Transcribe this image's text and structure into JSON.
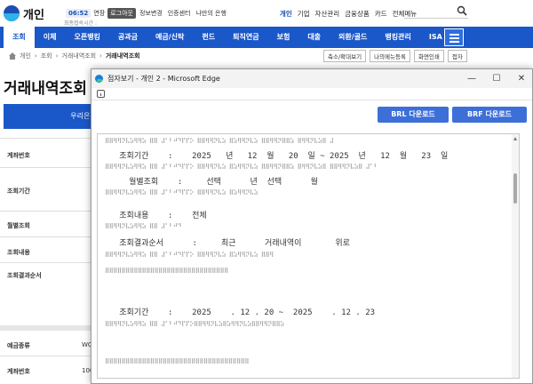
{
  "bank": {
    "logo_text": "개인",
    "session_timer": "06:52",
    "extend_label": "연장",
    "logout_label": "로그아웃",
    "top_links": [
      "정보변경",
      "인증센터",
      "나만의 은행"
    ],
    "biz_links": [
      "개인",
      "기업",
      "자산관리",
      "금융상품",
      "카드",
      "전체메뉴"
    ],
    "last_login": "최종접속시간 :",
    "nav": [
      "조회",
      "이체",
      "오픈뱅킹",
      "공과금",
      "예금/신탁",
      "펀드",
      "퇴직연금",
      "보험",
      "대출",
      "외환/골드",
      "뱅킹관리",
      "ISA"
    ],
    "breadcrumb": [
      "개인",
      "조회",
      "거래내역조회",
      "거래내역조회"
    ],
    "util_buttons": [
      "축소/확대보기",
      "나의메뉴등록",
      "화면인쇄",
      "접자"
    ],
    "page_title": "거래내역조회",
    "account_tab": "우리은행",
    "form_labels": [
      "계좌번호",
      "조회기간",
      "월별조회",
      "조회내용",
      "조회결과순서",
      "예금종류",
      "계좌번호"
    ],
    "side_values": [
      "WO",
      "100"
    ]
  },
  "popup": {
    "title": "점자보기 - 개인 2 - Microsoft Edge",
    "minimize": "—",
    "maximize": "☐",
    "close": "✕",
    "brl_button": "BRL 다운로드",
    "brf_button": "BRF 다운로드",
    "lines": [
      {
        "kind": "braille",
        "text": "⠿⠿⠻⠻⠝⠧⠵⠻⠻⠵ ⠿⠿ ⠼⠁⠃⠚⠙⠏⠏⠕ ⠿⠿⠻⠻⠝⠧⠵ ⠿⠵⠻⠻⠝⠧⠵ ⠿⠿⠻⠻⠝⠿⠿⠵ ⠿⠻⠻⠝⠧⠵⠿ ⠼"
      },
      {
        "kind": "text",
        "text": "   조회기간    :    2025   년   12  월   20  일 ~ 2025  년   12  월   23  일"
      },
      {
        "kind": "braille",
        "text": "⠿⠿⠻⠻⠝⠧⠵⠻⠻⠵ ⠿⠿ ⠼⠁⠃⠚⠙⠏⠏⠕ ⠿⠿⠻⠻⠝⠧⠵ ⠿⠵⠻⠻⠝⠧⠵ ⠿⠿⠻⠻⠝⠿⠿⠵ ⠿⠻⠻⠝⠧⠵⠿ ⠿⠿⠻⠻⠝⠧⠵⠿ ⠼⠁⠃"
      },
      {
        "kind": "text",
        "text": "     월별조회    :     선택      년  선택      월"
      },
      {
        "kind": "braille",
        "text": "⠿⠿⠻⠻⠝⠧⠵⠻⠻⠵ ⠿⠿ ⠼⠁⠃⠚⠙⠏⠏⠕ ⠿⠿⠻⠻⠝⠧⠵ ⠿⠵⠻⠻⠝⠧⠵"
      },
      {
        "kind": "text",
        "text": "   조회내용    :    전체"
      },
      {
        "kind": "braille",
        "text": "⠿⠿⠻⠻⠝⠧⠵⠻⠻⠵ ⠿⠿ ⠼⠁⠃⠚⠙"
      },
      {
        "kind": "text",
        "text": "   조회결과순서      :     최근      거래내역이       위로"
      },
      {
        "kind": "braille",
        "text": "⠿⠿⠻⠻⠝⠧⠵⠻⠻⠵ ⠿⠿ ⠼⠁⠃⠚⠙⠏⠏⠕ ⠿⠿⠻⠻⠝⠧⠵ ⠿⠵⠻⠻⠝⠧⠵ ⠿⠿⠻"
      },
      {
        "kind": "braille",
        "text": "⠿⠿⠿⠿⠿⠿⠿⠿⠿⠿⠿⠿⠿⠿⠿⠿⠿⠿⠿⠿⠿⠿⠿⠿⠿⠿⠿⠿⠿⠿"
      },
      {
        "kind": "text",
        "text": "   조회기간    :    2025    . 12 . 20 ~  2025    . 12 . 23"
      },
      {
        "kind": "braille",
        "text": "⠿⠿⠻⠻⠝⠧⠵⠻⠻⠵ ⠿⠿ ⠼⠁⠃⠚⠙⠏⠏⠕⠿⠿⠻⠻⠝⠧⠵⠿⠵⠻⠻⠝⠧⠵⠿⠿⠻⠻⠝⠿⠿⠵"
      },
      {
        "kind": "braille",
        "text": "⠿⠿⠿⠿⠿⠿⠿⠿⠿⠿⠿⠿⠿⠿⠿⠿⠿⠿⠿⠿⠿⠿⠿⠿⠿⠿⠿⠿⠿⠿⠿⠿⠿⠿⠿"
      }
    ]
  }
}
